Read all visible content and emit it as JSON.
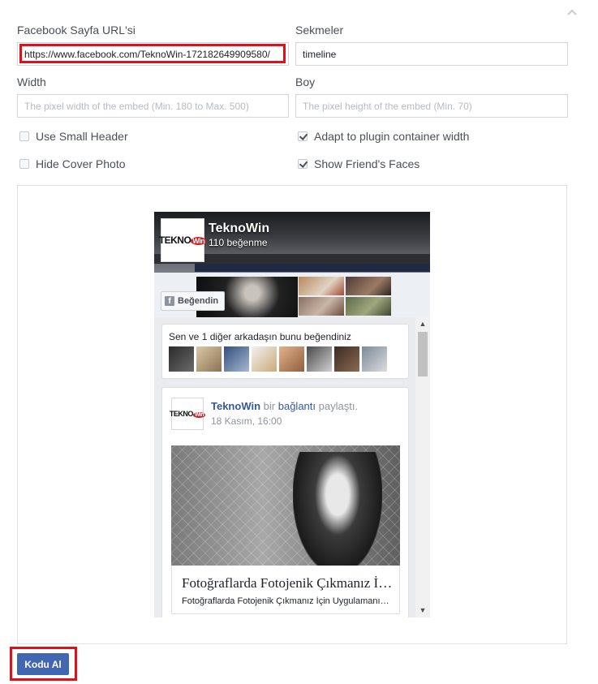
{
  "form": {
    "url_label": "Facebook Sayfa URL'si",
    "url_value": "https://www.facebook.com/TeknoWin-172182649909580/",
    "tabs_label": "Sekmeler",
    "tabs_value": "timeline",
    "width_label": "Width",
    "width_placeholder": "The pixel width of the embed (Min. 180 to Max. 500)",
    "height_label": "Boy",
    "height_placeholder": "The pixel height of the embed (Min. 70)",
    "options": {
      "small_header": {
        "label": "Use Small Header",
        "checked": false
      },
      "adapt_width": {
        "label": "Adapt to plugin container width",
        "checked": true
      },
      "hide_cover": {
        "label": "Hide Cover Photo",
        "checked": false
      },
      "show_faces": {
        "label": "Show Friend's Faces",
        "checked": true
      }
    }
  },
  "preview": {
    "page_name": "TeknoWin",
    "page_likes": "110 beğenme",
    "like_button": "Beğendin",
    "friends_text": "Sen ve 1 diğer arkadaşın bunu beğendiniz",
    "post": {
      "author": "TeknoWin",
      "action_prefix": "bir",
      "action_link": "bağlantı",
      "action_suffix": "paylaştı.",
      "date": "18 Kasım, 16:00",
      "link_title": "Fotoğraflarda Fotojenik Çıkmanız İçin Uygulamanız Gereken...",
      "link_desc": "Fotoğraflarda Fotojenik Çıkmanız İçin Uygulamanız Gereken Teknikler"
    },
    "logo": {
      "main": "TEKNO",
      "badge": "Win"
    }
  },
  "submit_label": "Kodu Al",
  "colors": {
    "accent": "#4267b2",
    "highlight": "#e0101b",
    "link": "#365899"
  },
  "icons": [
    "chevron-up-icon",
    "facebook-icon",
    "scroll-up-icon",
    "scroll-down-icon"
  ]
}
